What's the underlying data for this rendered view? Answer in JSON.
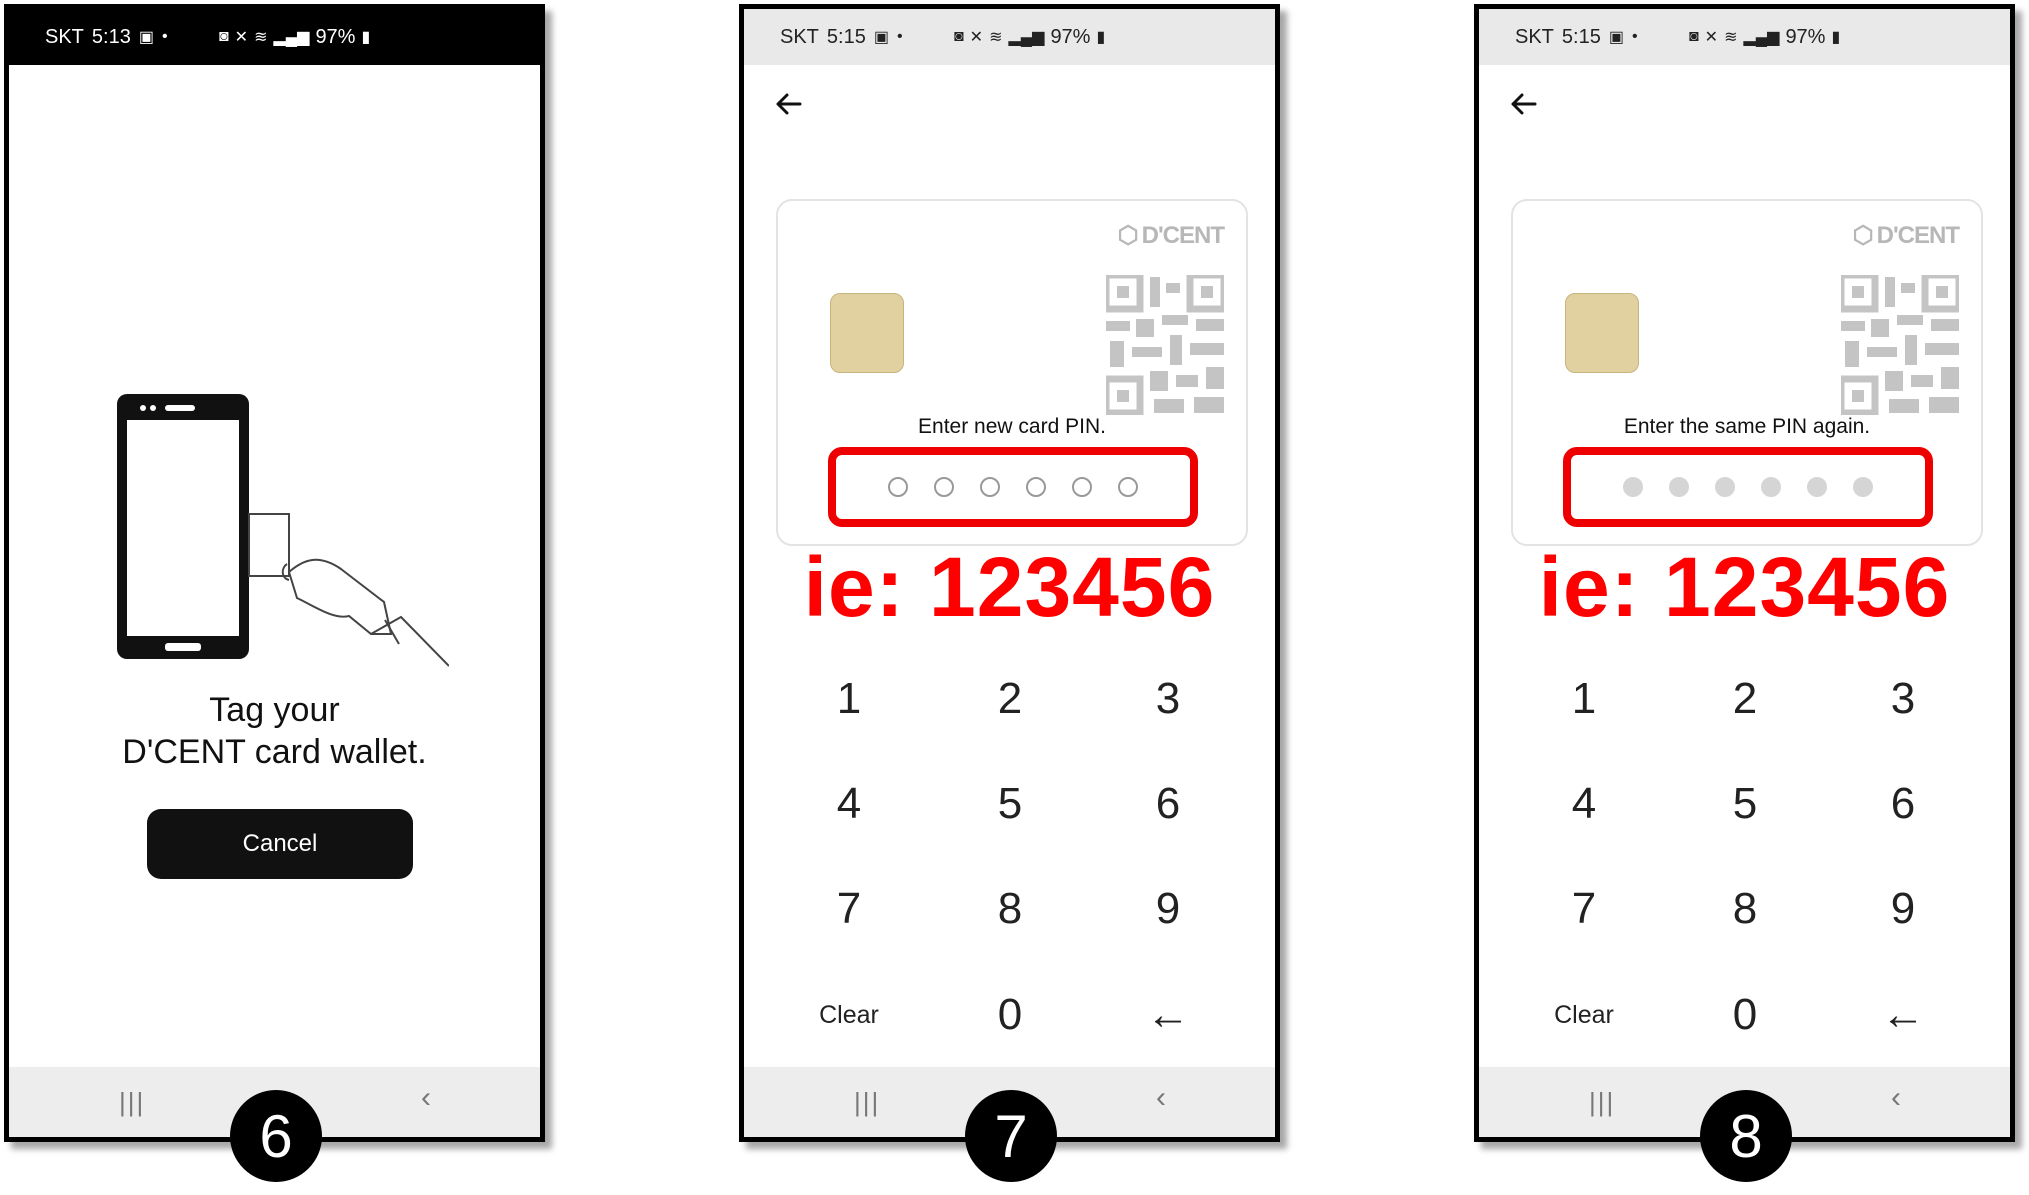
{
  "screens": {
    "s6": {
      "status": {
        "carrier": "SKT",
        "time": "5:13",
        "battery": "97%"
      },
      "tag_line1": "Tag your",
      "tag_line2": "D'CENT card wallet.",
      "cancel_label": "Cancel",
      "step": "6"
    },
    "s7": {
      "status": {
        "carrier": "SKT",
        "time": "5:15",
        "battery": "97%"
      },
      "brand": "D'CENT",
      "prompt": "Enter new card PIN.",
      "pin_filled": 0,
      "example": "ie: 123456",
      "keys": [
        "1",
        "2",
        "3",
        "4",
        "5",
        "6",
        "7",
        "8",
        "9",
        "Clear",
        "0",
        "←"
      ],
      "step": "7"
    },
    "s8": {
      "status": {
        "carrier": "SKT",
        "time": "5:15",
        "battery": "97%"
      },
      "brand": "D'CENT",
      "prompt": "Enter the same PIN again.",
      "pin_filled": 6,
      "example": "ie: 123456",
      "keys": [
        "1",
        "2",
        "3",
        "4",
        "5",
        "6",
        "7",
        "8",
        "9",
        "Clear",
        "0",
        "←"
      ],
      "step": "8"
    }
  },
  "colors": {
    "highlight": "#ee0000",
    "example_text": "#ff0000",
    "button_bg": "#111111"
  }
}
